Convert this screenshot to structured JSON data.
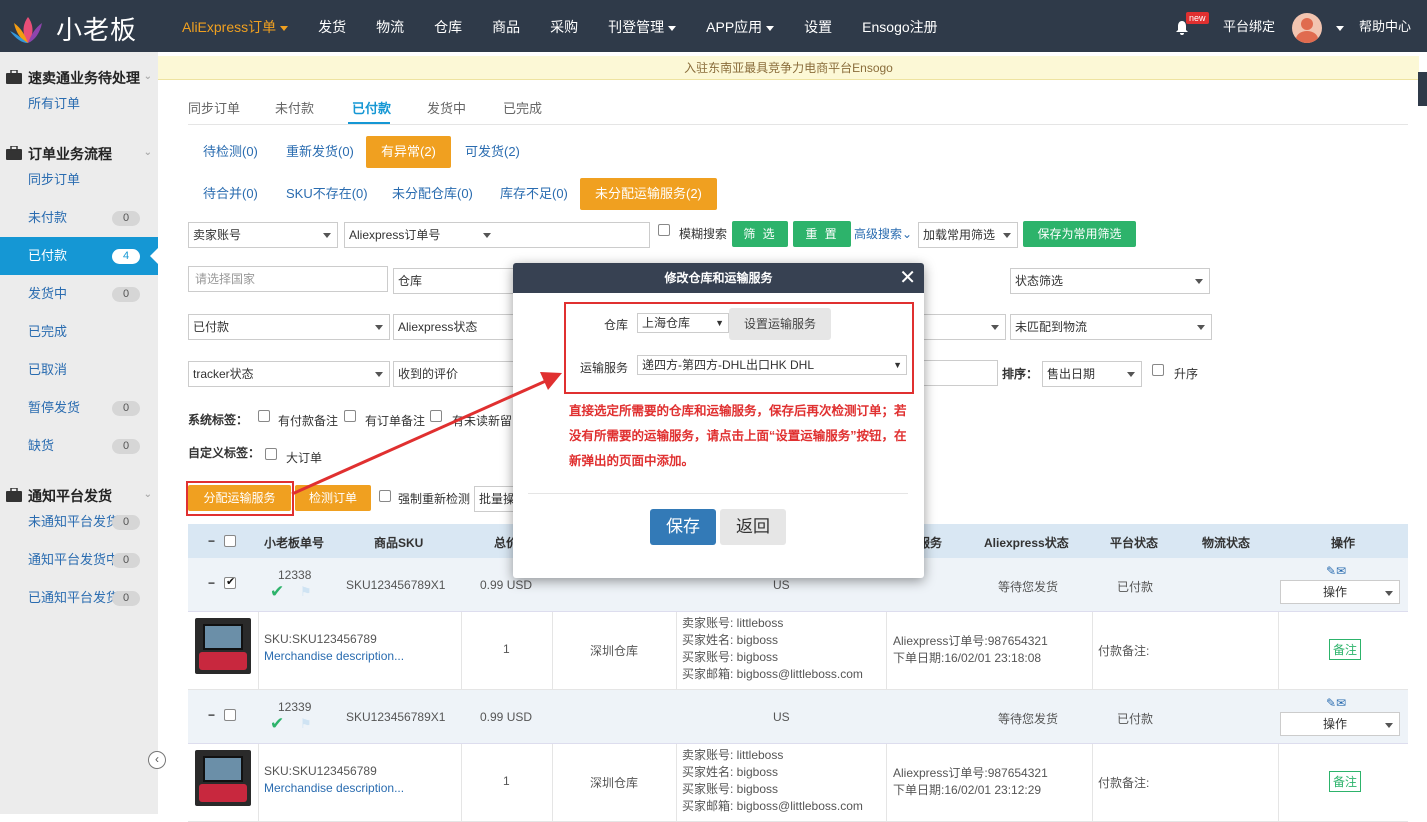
{
  "app": {
    "logo_text": "小老板"
  },
  "topnav": {
    "items": [
      {
        "label": "AliExpress订单",
        "caret": true,
        "active": true
      },
      {
        "label": "发货",
        "caret": false
      },
      {
        "label": "物流",
        "caret": false
      },
      {
        "label": "仓库",
        "caret": false
      },
      {
        "label": "商品",
        "caret": false
      },
      {
        "label": "采购",
        "caret": false
      },
      {
        "label": "刊登管理",
        "caret": true
      },
      {
        "label": "APP应用",
        "caret": true
      },
      {
        "label": "设置",
        "caret": false
      },
      {
        "label": "Ensogo注册",
        "caret": false
      }
    ],
    "new_badge": "new",
    "platform_bind": "平台绑定",
    "help": "帮助中心"
  },
  "sidebar": {
    "sections": [
      {
        "title": "速卖通业务待处理",
        "items": [
          {
            "label": "所有订单",
            "badge": ""
          }
        ]
      },
      {
        "title": "订单业务流程",
        "items": [
          {
            "label": "同步订单",
            "badge": ""
          },
          {
            "label": "未付款",
            "badge": "0"
          },
          {
            "label": "已付款",
            "badge": "4",
            "active": true
          },
          {
            "label": "发货中",
            "badge": "0"
          },
          {
            "label": "已完成",
            "badge": ""
          },
          {
            "label": "已取消",
            "badge": ""
          },
          {
            "label": "暂停发货",
            "badge": "0"
          },
          {
            "label": "缺货",
            "badge": "0"
          }
        ]
      },
      {
        "title": "通知平台发货",
        "items": [
          {
            "label": "未通知平台发货",
            "badge": "0"
          },
          {
            "label": "通知平台发货中",
            "badge": "0"
          },
          {
            "label": "已通知平台发货",
            "badge": "0"
          }
        ]
      }
    ]
  },
  "notice": "入驻东南亚最具竞争力电商平台Ensogo",
  "tabs": [
    "同步订单",
    "未付款",
    "已付款",
    "发货中",
    "已完成"
  ],
  "filters_row1": [
    {
      "label": "待检测(0)"
    },
    {
      "label": "重新发货(0)"
    },
    {
      "label": "有异常(2)",
      "active": true
    },
    {
      "label": "可发货(2)"
    }
  ],
  "filters_row2": [
    {
      "label": "待合并(0)"
    },
    {
      "label": "SKU不存在(0)"
    },
    {
      "label": "未分配仓库(0)"
    },
    {
      "label": "库存不足(0)"
    },
    {
      "label": "未分配运输服务(2)",
      "active": true
    }
  ],
  "search": {
    "seller_account": "卖家账号",
    "order_no_type": "Aliexpress订单号",
    "fuzzy": "模糊搜索",
    "filter_btn": "筛 选",
    "reset_btn": "重 置",
    "advanced": "高级搜索",
    "load_common": "加载常用筛选",
    "save_common": "保存为常用筛选",
    "country_ph": "请选择国家",
    "warehouse": "仓库",
    "status_filter": "状态筛选",
    "paid": "已付款",
    "ali_status": "Aliexpress状态",
    "unmatched_logistics": "未匹配到物流",
    "tracker": "tracker状态",
    "review": "收到的评价",
    "sort_label": "排序：",
    "sort_value": "售出日期",
    "asc": "升序"
  },
  "tags": {
    "system_label": "系统标签：",
    "system": [
      "有付款备注",
      "有订单备注",
      "有未读新留"
    ],
    "custom_label": "自定义标签：",
    "custom": [
      "大订单"
    ]
  },
  "actions": {
    "assign_shipping": "分配运输服务",
    "check_order": "检测订单",
    "force_recheck": "强制重新检测",
    "batch": "批量操"
  },
  "table": {
    "headers": [
      "小老板单号",
      "商品SKU",
      "总价",
      "服务",
      "Aliexpress状态",
      "平台状态",
      "物流状态",
      "操作"
    ],
    "orders": [
      {
        "order_no": "12338",
        "sku": "SKU123456789X1",
        "total": "0.99 USD",
        "country": "US",
        "ali_status": "等待您发货",
        "platform_status": "已付款",
        "op": "操作",
        "checked": true,
        "item": {
          "sku": "SKU:SKU123456789",
          "desc": "Merchandise description...",
          "qty": "1",
          "warehouse": "深圳仓库",
          "buyer_lines": [
            "卖家账号: littleboss",
            "买家姓名: bigboss",
            "买家账号: bigboss",
            "买家邮箱: bigboss@littleboss.com"
          ],
          "ali_order": "Aliexpress订单号:987654321",
          "order_date": "下单日期:16/02/01 23:18:08",
          "pay_note": "付款备注:",
          "note_btn": "备注"
        }
      },
      {
        "order_no": "12339",
        "sku": "SKU123456789X1",
        "total": "0.99 USD",
        "country": "US",
        "ali_status": "等待您发货",
        "platform_status": "已付款",
        "op": "操作",
        "checked": false,
        "item": {
          "sku": "SKU:SKU123456789",
          "desc": "Merchandise description...",
          "qty": "1",
          "warehouse": "深圳仓库",
          "buyer_lines": [
            "卖家账号: littleboss",
            "买家姓名: bigboss",
            "买家账号: bigboss",
            "买家邮箱: bigboss@littleboss.com"
          ],
          "ali_order": "Aliexpress订单号:987654321",
          "order_date": "下单日期:16/02/01 23:12:29",
          "pay_note": "付款备注:",
          "note_btn": "备注"
        }
      }
    ]
  },
  "modal": {
    "title": "修改仓库和运输服务",
    "warehouse_label": "仓库",
    "warehouse_value": "上海仓库",
    "set_shipping_btn": "设置运输服务",
    "shipping_label": "运输服务",
    "shipping_value": "递四方-第四方-DHL出口HK DHL",
    "hint": "直接选定所需要的仓库和运输服务，保存后再次检测订单；若没有所需要的运输服务，请点击上面“设置运输服务”按钮，在新弹出的页面中添加。",
    "save_btn": "保存",
    "back_btn": "返回"
  },
  "colors": {
    "nav_bg": "#2f3a49",
    "accent_orange": "#f0a020",
    "accent_blue": "#1597d4",
    "green": "#2db36b",
    "annotation_red": "#e03030"
  }
}
